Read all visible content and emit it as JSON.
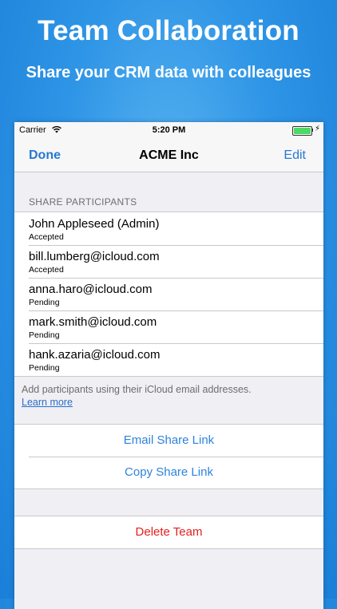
{
  "promo": {
    "title": "Team Collaboration",
    "subtitle": "Share your CRM data with colleagues"
  },
  "status_bar": {
    "carrier": "Carrier",
    "time": "5:20 PM"
  },
  "nav": {
    "left": "Done",
    "title": "ACME Inc",
    "right": "Edit"
  },
  "participants": {
    "header": "SHARE PARTICIPANTS",
    "items": [
      {
        "name": "John Appleseed (Admin)",
        "status": "Accepted"
      },
      {
        "name": "bill.lumberg@icloud.com",
        "status": "Accepted"
      },
      {
        "name": "anna.haro@icloud.com",
        "status": "Pending"
      },
      {
        "name": "mark.smith@icloud.com",
        "status": "Pending"
      },
      {
        "name": "hank.azaria@icloud.com",
        "status": "Pending"
      }
    ],
    "footer": "Add participants using their iCloud email addresses.",
    "learn_more": "Learn more"
  },
  "actions": {
    "email_link": "Email Share Link",
    "copy_link": "Copy Share Link",
    "delete_team": "Delete Team"
  },
  "colors": {
    "accent": "#2e83dc",
    "destructive": "#e2211c",
    "battery": "#4cd964"
  }
}
